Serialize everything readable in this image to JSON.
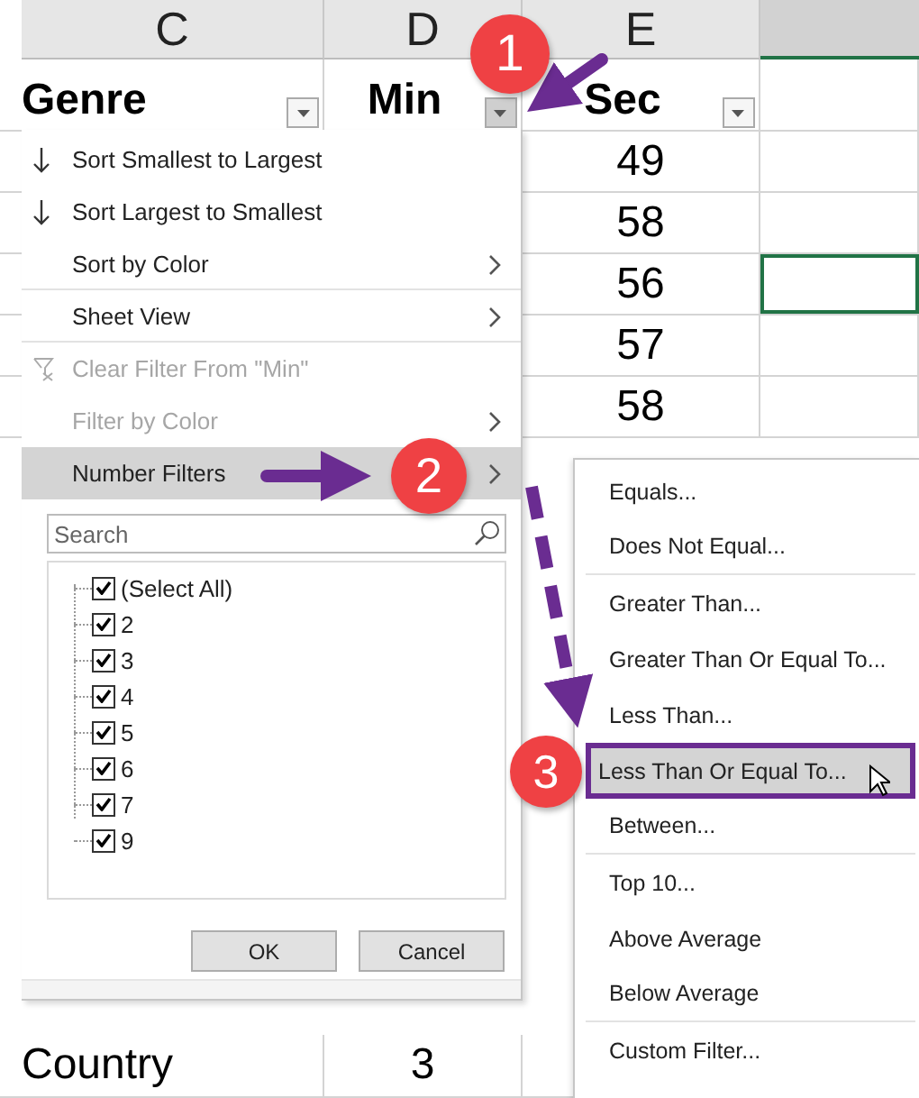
{
  "sheet": {
    "column_letters": [
      "C",
      "D",
      "E"
    ],
    "extra_column_highlighted": true,
    "headers": [
      {
        "label": "Genre",
        "filter_active": false
      },
      {
        "label": "Min",
        "filter_active": true
      },
      {
        "label": "Sec",
        "filter_active": false
      }
    ],
    "rows": [
      {
        "sec": "49",
        "f_selected": false
      },
      {
        "sec": "58",
        "f_selected": false
      },
      {
        "sec": "56",
        "f_selected": true
      },
      {
        "sec": "57",
        "f_selected": false
      },
      {
        "sec": "58",
        "f_selected": false
      }
    ],
    "bottom_rows": [
      {
        "genre": "Country",
        "min": "3"
      }
    ]
  },
  "filter_menu": {
    "items": [
      {
        "kind": "sort_ascending",
        "label": "Sort Smallest to Largest",
        "disabled": false,
        "highlighted": false,
        "submenu": false,
        "separator_after": false
      },
      {
        "kind": "sort_descending",
        "label": "Sort Largest to Smallest",
        "disabled": false,
        "highlighted": false,
        "submenu": false,
        "separator_after": false
      },
      {
        "kind": "plain",
        "label": "Sort by Color",
        "disabled": false,
        "highlighted": false,
        "submenu": true,
        "separator_after": true
      },
      {
        "kind": "plain",
        "label": "Sheet View",
        "disabled": false,
        "highlighted": false,
        "submenu": true,
        "separator_after": true
      },
      {
        "kind": "clear_filter",
        "label": "Clear Filter From \"Min\"",
        "disabled": true,
        "highlighted": false,
        "submenu": false,
        "separator_after": false
      },
      {
        "kind": "plain",
        "label": "Filter by Color",
        "disabled": true,
        "highlighted": false,
        "submenu": true,
        "separator_after": false
      },
      {
        "kind": "plain",
        "label": "Number Filters",
        "disabled": false,
        "highlighted": true,
        "submenu": true,
        "separator_after": false
      }
    ],
    "search": {
      "placeholder": "Search"
    },
    "values": [
      {
        "label": "(Select All)",
        "checked": true
      },
      {
        "label": "2",
        "checked": true
      },
      {
        "label": "3",
        "checked": true
      },
      {
        "label": "4",
        "checked": true
      },
      {
        "label": "5",
        "checked": true
      },
      {
        "label": "6",
        "checked": true
      },
      {
        "label": "7",
        "checked": true
      },
      {
        "label": "9",
        "checked": true
      }
    ],
    "buttons": [
      "OK",
      "Cancel"
    ]
  },
  "number_filters_menu": {
    "items": [
      {
        "label": "Equals...",
        "highlighted": false,
        "separator_after": false
      },
      {
        "label": "Does Not Equal...",
        "highlighted": false,
        "separator_after": true
      },
      {
        "label": "Greater Than...",
        "highlighted": false,
        "separator_after": false
      },
      {
        "label": "Greater Than Or Equal To...",
        "highlighted": false,
        "separator_after": false
      },
      {
        "label": "Less Than...",
        "highlighted": false,
        "separator_after": false
      },
      {
        "label": "Less Than Or Equal To...",
        "highlighted": true,
        "separator_after": false
      },
      {
        "label": "Between...",
        "highlighted": false,
        "separator_after": true
      },
      {
        "label": "Top 10...",
        "highlighted": false,
        "separator_after": false
      },
      {
        "label": "Above Average",
        "highlighted": false,
        "separator_after": false
      },
      {
        "label": "Below Average",
        "highlighted": false,
        "separator_after": true
      },
      {
        "label": "Custom Filter...",
        "highlighted": false,
        "separator_after": false
      }
    ]
  },
  "annotations": [
    {
      "number": "1"
    },
    {
      "number": "2"
    },
    {
      "number": "3"
    }
  ]
}
